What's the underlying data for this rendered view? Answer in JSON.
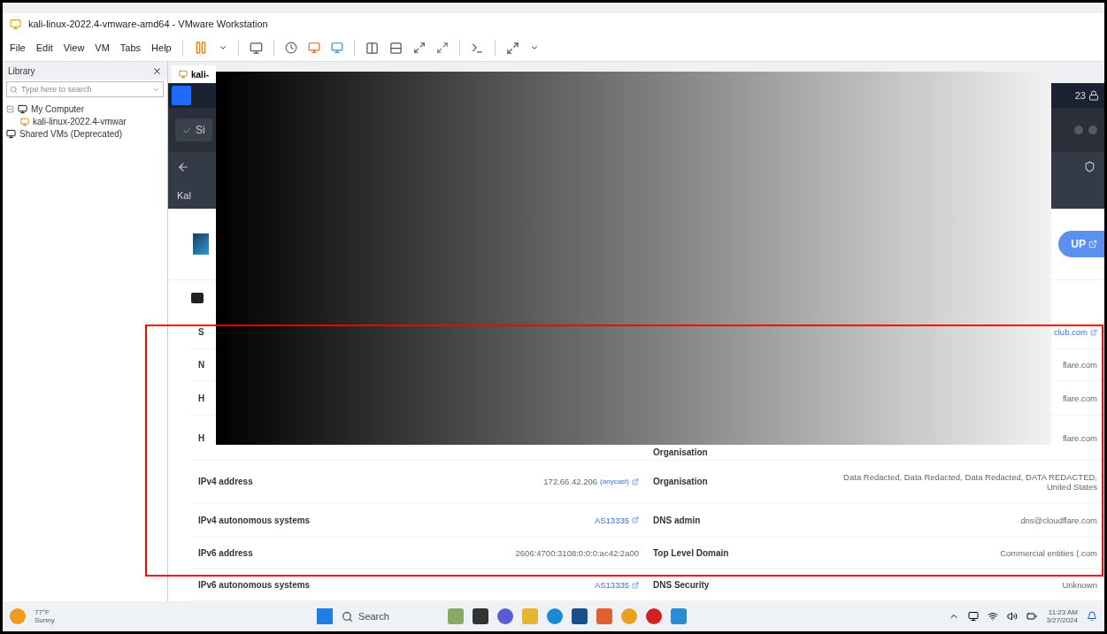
{
  "window": {
    "title": "kali-linux-2022.4-vmware-amd64 - VMware Workstation"
  },
  "menu": [
    "File",
    "Edit",
    "View",
    "VM",
    "Tabs",
    "Help"
  ],
  "library": {
    "title": "Library",
    "search": {
      "placeholder": "Type here to search"
    },
    "tree": [
      {
        "label": "My Computer",
        "expanded": true,
        "children": [
          {
            "label": "kali-linux-2022.4-vmwar"
          }
        ]
      },
      {
        "label": "Shared VMs (Deprecated)"
      }
    ]
  },
  "vm_tab": {
    "label": "kali-"
  },
  "guest": {
    "clock": "23",
    "browser_tab": "Si",
    "bookmark": "Kal",
    "lookup_button": "UP"
  },
  "details": [
    {
      "left_label": "S",
      "right_value": "club.com",
      "right_is_link": true
    },
    {
      "left_label": "N",
      "right_value": "flare.com",
      "right_is_link": false
    },
    {
      "left_label": "H",
      "right_value": "flare.com",
      "right_is_link": false
    },
    {
      "left_label": "H",
      "right_label": "Organisation",
      "right_value": "flare.com",
      "right_is_link": false
    },
    {
      "left_label": "IPv4 address",
      "left_value": "172.66.42.206",
      "left_anycast": "(anycast)",
      "right_label": "Organisation",
      "right_value": "Data Redacted, Data Redacted, Data Redacted, DATA REDACTED,",
      "right_value2": "United States",
      "right_is_link": false
    },
    {
      "left_label": "IPv4 autonomous systems",
      "left_value": "AS13335",
      "left_is_link": true,
      "right_label": "DNS admin",
      "right_value": "dns@cloudflare.com",
      "right_is_link": false
    },
    {
      "left_label": "IPv6 address",
      "left_value": "2606:4700:3108:0:0:0:ac42:2a00",
      "left_is_link": false,
      "right_label": "Top Level Domain",
      "right_value": "Commercial entities (.com",
      "right_is_link": false
    },
    {
      "left_label": "IPv6 autonomous systems",
      "left_value": "AS13335",
      "left_is_link": true,
      "right_label": "DNS Security",
      "right_value": "Unknown",
      "right_is_link": false
    }
  ],
  "taskbar": {
    "weather_temp": "77°F",
    "weather_text": "Sunny",
    "search": "Search",
    "time": "11:23 AM",
    "date": "3/27/2024"
  }
}
